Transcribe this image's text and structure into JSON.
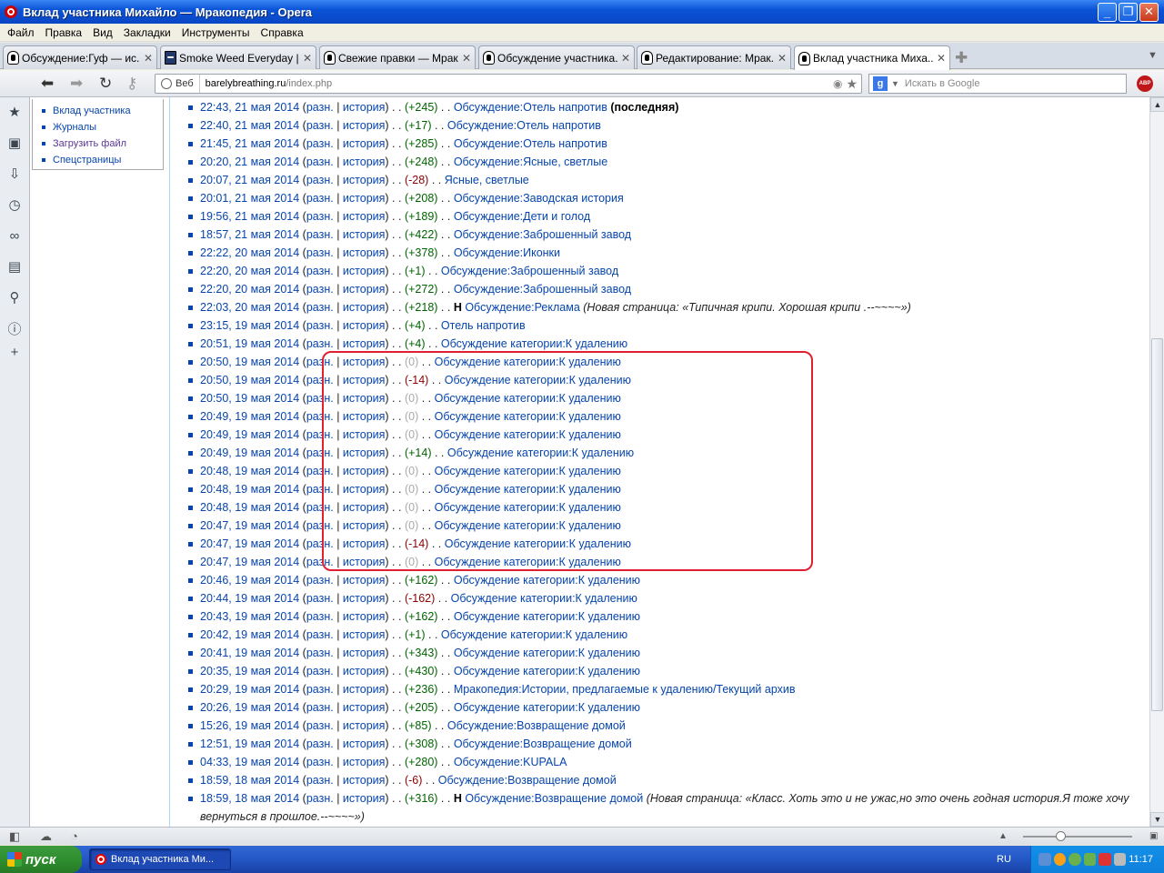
{
  "window": {
    "title": "Вклад участника Михайло — Мракопедия - Opera"
  },
  "menu": [
    "Файл",
    "Правка",
    "Вид",
    "Закладки",
    "Инструменты",
    "Справка"
  ],
  "tabs": [
    {
      "label": "Обсуждение:Гуф — ис..."
    },
    {
      "label": "Smoke Weed Everyday |..."
    },
    {
      "label": "Свежие правки — Мрак..."
    },
    {
      "label": "Обсуждение участника..."
    },
    {
      "label": "Редактирование: Мрак..."
    },
    {
      "label": "Вклад участника Миха..."
    }
  ],
  "address": {
    "web_label": "Веб",
    "host": "barelybreathing.ru",
    "path": "/index.php"
  },
  "search": {
    "placeholder": "Искать в Google"
  },
  "sidebar": {
    "items": [
      "Вклад участника",
      "Журналы",
      "Загрузить файл",
      "Спецстраницы"
    ]
  },
  "labels": {
    "diff": "разн.",
    "sep": " | ",
    "hist": "история",
    "dots": " . . ",
    "new_flag": "Н",
    "latest": "(последняя)"
  },
  "contributions": [
    {
      "time": "22:43, 21 мая 2014",
      "size": "(+245)",
      "kind": "pos",
      "page": "Обсуждение:Отель напротив",
      "latest": true
    },
    {
      "time": "22:40, 21 мая 2014",
      "size": "(+17)",
      "kind": "pos",
      "page": "Обсуждение:Отель напротив"
    },
    {
      "time": "21:45, 21 мая 2014",
      "size": "(+285)",
      "kind": "pos",
      "page": "Обсуждение:Отель напротив"
    },
    {
      "time": "20:20, 21 мая 2014",
      "size": "(+248)",
      "kind": "pos",
      "page": "Обсуждение:Ясные, светлые"
    },
    {
      "time": "20:07, 21 мая 2014",
      "size": "(-28)",
      "kind": "neg",
      "page": "Ясные, светлые"
    },
    {
      "time": "20:01, 21 мая 2014",
      "size": "(+208)",
      "kind": "pos",
      "page": "Обсуждение:Заводская история"
    },
    {
      "time": "19:56, 21 мая 2014",
      "size": "(+189)",
      "kind": "pos",
      "page": "Обсуждение:Дети и голод"
    },
    {
      "time": "18:57, 21 мая 2014",
      "size": "(+422)",
      "kind": "pos",
      "page": "Обсуждение:Заброшенный завод"
    },
    {
      "time": "22:22, 20 мая 2014",
      "size": "(+378)",
      "kind": "pos",
      "page": "Обсуждение:Иконки"
    },
    {
      "time": "22:20, 20 мая 2014",
      "size": "(+1)",
      "kind": "pos",
      "page": "Обсуждение:Заброшенный завод"
    },
    {
      "time": "22:20, 20 мая 2014",
      "size": "(+272)",
      "kind": "pos",
      "page": "Обсуждение:Заброшенный завод"
    },
    {
      "time": "22:03, 20 мая 2014",
      "size": "(+218)",
      "kind": "pos",
      "new": true,
      "page": "Обсуждение:Реклама",
      "comment": "(Новая страница: «Типичная крипи. Хорошая крипи .--~~~~»)"
    },
    {
      "time": "23:15, 19 мая 2014",
      "size": "(+4)",
      "kind": "pos",
      "page": "Отель напротив"
    },
    {
      "time": "20:51, 19 мая 2014",
      "size": "(+4)",
      "kind": "pos",
      "page": "Обсуждение категории:К удалению"
    },
    {
      "time": "20:50, 19 мая 2014",
      "size": "(0)",
      "kind": "nul",
      "page": "Обсуждение категории:К удалению"
    },
    {
      "time": "20:50, 19 мая 2014",
      "size": "(-14)",
      "kind": "neg",
      "page": "Обсуждение категории:К удалению"
    },
    {
      "time": "20:50, 19 мая 2014",
      "size": "(0)",
      "kind": "nul",
      "page": "Обсуждение категории:К удалению"
    },
    {
      "time": "20:49, 19 мая 2014",
      "size": "(0)",
      "kind": "nul",
      "page": "Обсуждение категории:К удалению"
    },
    {
      "time": "20:49, 19 мая 2014",
      "size": "(0)",
      "kind": "nul",
      "page": "Обсуждение категории:К удалению"
    },
    {
      "time": "20:49, 19 мая 2014",
      "size": "(+14)",
      "kind": "pos",
      "page": "Обсуждение категории:К удалению"
    },
    {
      "time": "20:48, 19 мая 2014",
      "size": "(0)",
      "kind": "nul",
      "page": "Обсуждение категории:К удалению"
    },
    {
      "time": "20:48, 19 мая 2014",
      "size": "(0)",
      "kind": "nul",
      "page": "Обсуждение категории:К удалению"
    },
    {
      "time": "20:48, 19 мая 2014",
      "size": "(0)",
      "kind": "nul",
      "page": "Обсуждение категории:К удалению"
    },
    {
      "time": "20:47, 19 мая 2014",
      "size": "(0)",
      "kind": "nul",
      "page": "Обсуждение категории:К удалению"
    },
    {
      "time": "20:47, 19 мая 2014",
      "size": "(-14)",
      "kind": "neg",
      "page": "Обсуждение категории:К удалению"
    },
    {
      "time": "20:47, 19 мая 2014",
      "size": "(0)",
      "kind": "nul",
      "page": "Обсуждение категории:К удалению"
    },
    {
      "time": "20:46, 19 мая 2014",
      "size": "(+162)",
      "kind": "pos",
      "page": "Обсуждение категории:К удалению"
    },
    {
      "time": "20:44, 19 мая 2014",
      "size": "(-162)",
      "kind": "neg",
      "page": "Обсуждение категории:К удалению"
    },
    {
      "time": "20:43, 19 мая 2014",
      "size": "(+162)",
      "kind": "pos",
      "page": "Обсуждение категории:К удалению"
    },
    {
      "time": "20:42, 19 мая 2014",
      "size": "(+1)",
      "kind": "pos",
      "page": "Обсуждение категории:К удалению"
    },
    {
      "time": "20:41, 19 мая 2014",
      "size": "(+343)",
      "kind": "pos",
      "page": "Обсуждение категории:К удалению"
    },
    {
      "time": "20:35, 19 мая 2014",
      "size": "(+430)",
      "kind": "pos",
      "page": "Обсуждение категории:К удалению"
    },
    {
      "time": "20:29, 19 мая 2014",
      "size": "(+236)",
      "kind": "pos",
      "page": "Мракопедия:Истории, предлагаемые к удалению/Текущий архив"
    },
    {
      "time": "20:26, 19 мая 2014",
      "size": "(+205)",
      "kind": "pos",
      "page": "Обсуждение категории:К удалению"
    },
    {
      "time": "15:26, 19 мая 2014",
      "size": "(+85)",
      "kind": "pos",
      "page": "Обсуждение:Возвращение домой"
    },
    {
      "time": "12:51, 19 мая 2014",
      "size": "(+308)",
      "kind": "pos",
      "page": "Обсуждение:Возвращение домой"
    },
    {
      "time": "04:33, 19 мая 2014",
      "size": "(+280)",
      "kind": "pos",
      "page": "Обсуждение:KUPALA"
    },
    {
      "time": "18:59, 18 мая 2014",
      "size": "(-6)",
      "kind": "neg",
      "page": "Обсуждение:Возвращение домой"
    },
    {
      "time": "18:59, 18 мая 2014",
      "size": "(+316)",
      "kind": "pos",
      "new": true,
      "page": "Обсуждение:Возвращение домой",
      "comment": "(Новая страница: «Класс. Хоть это и не ужас,но это очень годная история.Я тоже хочу вернуться в прошлое.--~~~~»)"
    }
  ],
  "colors": {
    "link": "#0645ad",
    "positive": "#006400",
    "negative": "#8b0000",
    "zero": "#aaaaaa",
    "highlight": "#e02030"
  },
  "taskbar": {
    "start": "пуск",
    "task": "Вклад участника Ми...",
    "lang": "RU",
    "clock": "11:17"
  }
}
